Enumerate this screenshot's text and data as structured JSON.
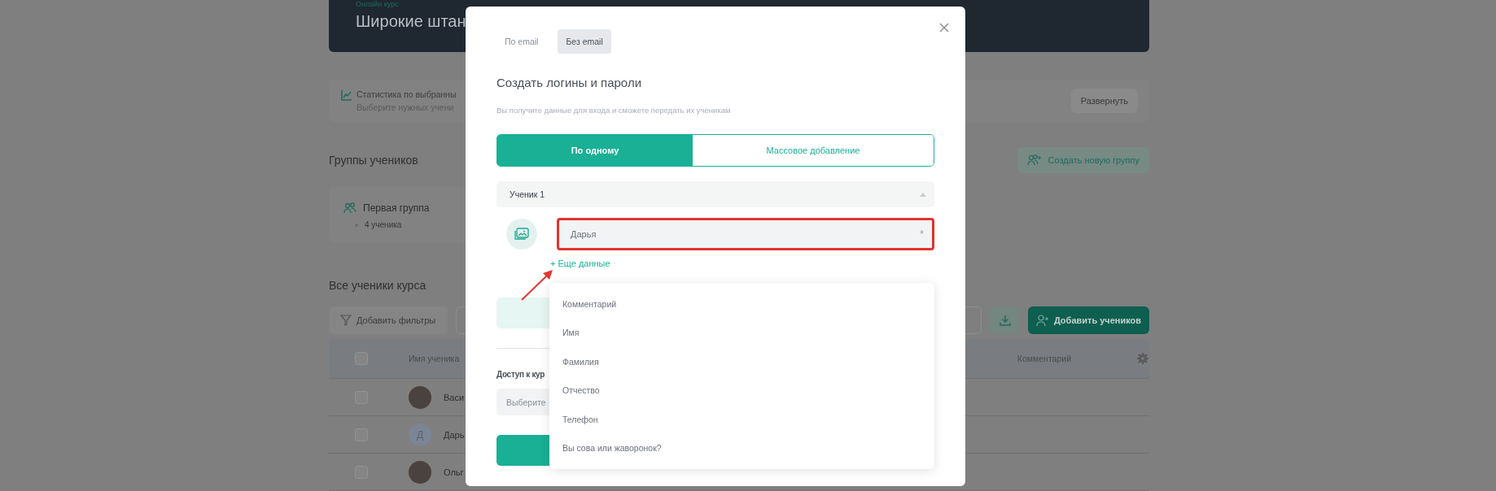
{
  "background": {
    "course_label": "Онлайн курс",
    "course_title": "Широкие штан",
    "stats": {
      "title": "Статистика по выбранны",
      "subtitle": "Выберите нужных учени",
      "button": "Развернуть"
    },
    "groups": {
      "heading": "Группы учеников",
      "create_button": "Создать новую группу",
      "items": [
        {
          "name": "Первая группа",
          "count": "4 ученика"
        }
      ]
    },
    "students": {
      "heading": "Все ученики курса",
      "filter_button": "Добавить фильтры",
      "add_button": "Добавить учеников",
      "all_checked": false,
      "columns": [
        "Имя ученика",
        "Комментарий"
      ],
      "rows": [
        {
          "name": "Васи",
          "checked": false,
          "avatar": {
            "kind": "photo"
          }
        },
        {
          "name": "Дарь",
          "checked": false,
          "avatar": {
            "kind": "letter",
            "letter": "Д"
          }
        },
        {
          "name": "Ольг",
          "checked": false,
          "avatar": {
            "kind": "photo"
          }
        }
      ]
    }
  },
  "modal": {
    "tabs": [
      {
        "label": "По email",
        "selected": false
      },
      {
        "label": "Без email",
        "selected": true
      }
    ],
    "title": "Создать логины и пароли",
    "subtitle": "Вы получите данные для входа и сможете передать их ученикам",
    "modes": [
      {
        "label": "По одному",
        "selected": true
      },
      {
        "label": "Массовое добавление",
        "selected": false
      }
    ],
    "student": {
      "title": "Ученик 1",
      "expanded": true,
      "name_field": {
        "value": "Дарья",
        "required_mark": "*",
        "highlighted": true
      },
      "more_link": "+ Еще данные"
    },
    "access": {
      "label": "Доступ к кур",
      "placeholder": "Выберите"
    },
    "dropdown": {
      "items": [
        "Комментарий",
        "Имя",
        "Фамилия",
        "Отчество",
        "Телефон",
        "Вы сова или жаворонок?"
      ]
    }
  }
}
